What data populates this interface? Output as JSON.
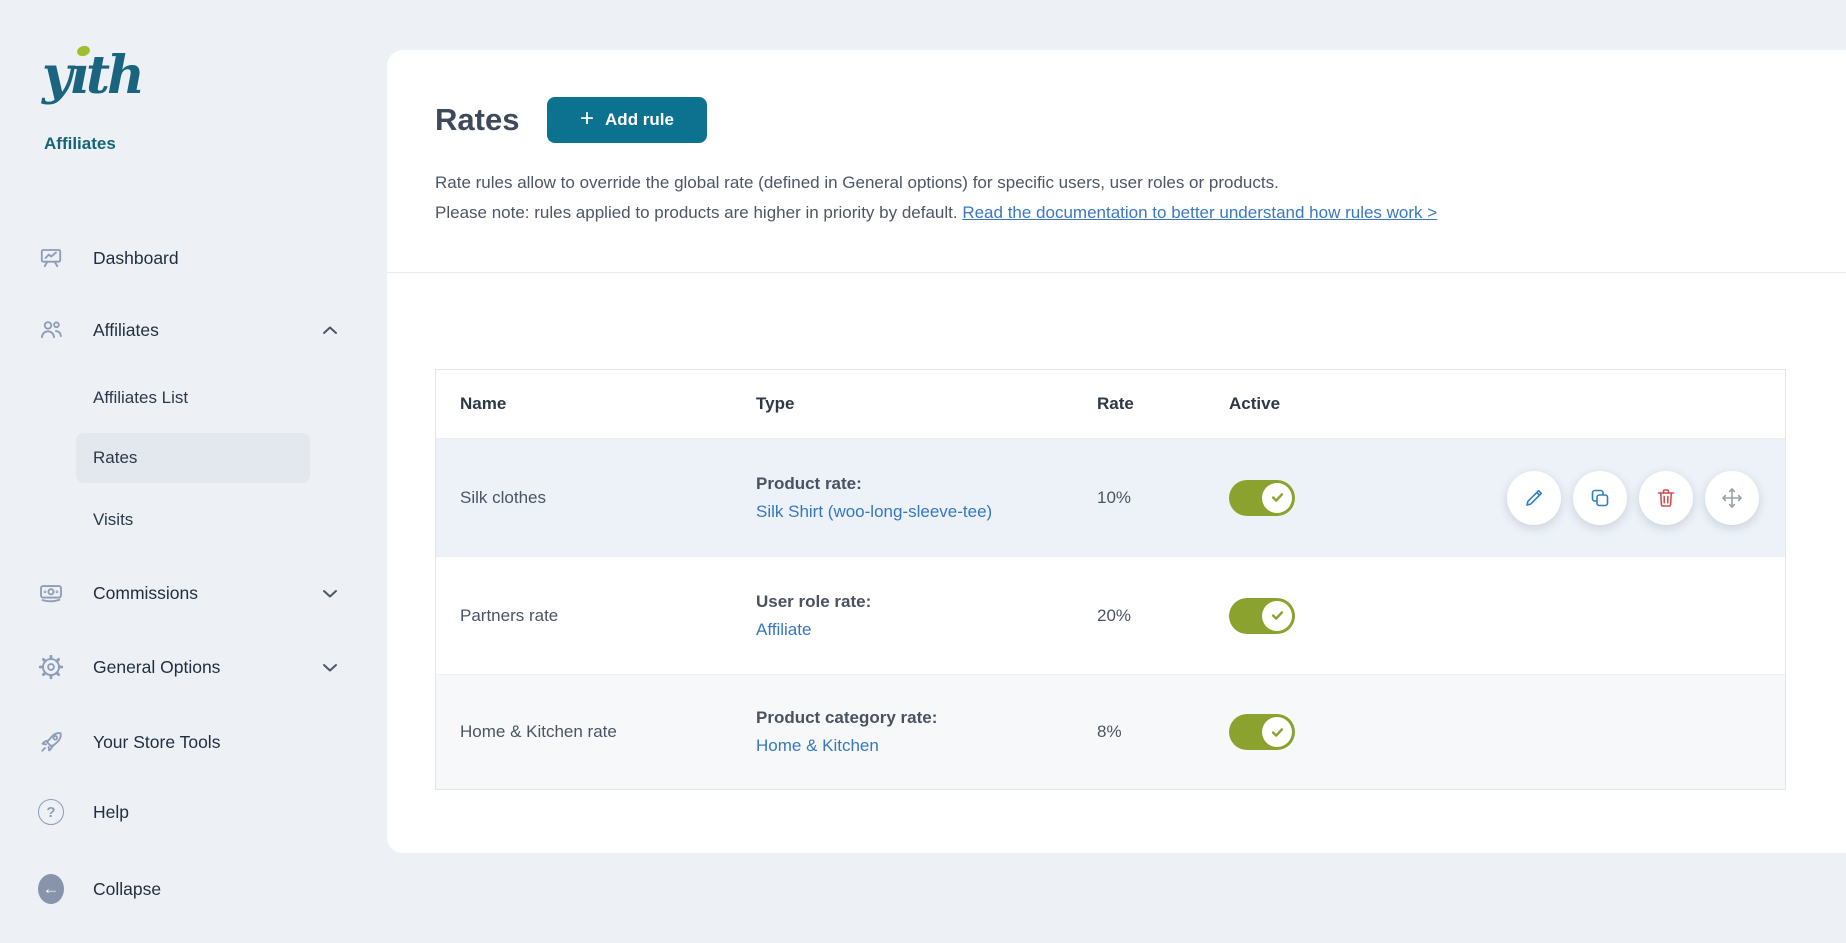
{
  "brand": {
    "logo": "yıth",
    "product": "Affiliates"
  },
  "glyphs": {
    "plus": "+",
    "question": "?",
    "back_arrow": "←"
  },
  "sidebar": {
    "items": [
      {
        "label": "Dashboard",
        "icon": "dashboard-icon"
      },
      {
        "label": "Affiliates",
        "icon": "users-icon",
        "chevron": "up",
        "expanded": true
      },
      {
        "label": "Affiliates List",
        "submenu": true
      },
      {
        "label": "Rates",
        "submenu": true,
        "active": true
      },
      {
        "label": "Visits",
        "submenu": true
      },
      {
        "label": "Commissions",
        "icon": "banknote-icon",
        "chevron": "down"
      },
      {
        "label": "General Options",
        "icon": "gear-icon",
        "chevron": "down"
      },
      {
        "label": "Your Store Tools",
        "icon": "rocket-icon"
      },
      {
        "label": "Help",
        "icon": "help-icon"
      },
      {
        "label": "Collapse",
        "icon": "collapse-arrow-icon"
      }
    ]
  },
  "header": {
    "title": "Rates",
    "add_rule_label": "Add rule",
    "description_line1": "Rate rules allow to override the global rate (defined in General options) for specific users, user roles or products.",
    "description_line2": "Please note: rules applied to products are higher in priority by default.",
    "doc_link": "Read the documentation to better understand how rules work >"
  },
  "table": {
    "columns": [
      "Name",
      "Type",
      "Rate",
      "Active"
    ],
    "rows": [
      {
        "name": "Silk clothes",
        "type_label": "Product rate:",
        "type_link": "Silk Shirt (woo-long-sleeve-tee)",
        "rate": "10%",
        "active": true
      },
      {
        "name": "Partners rate",
        "type_label": "User role rate:",
        "type_link": "Affiliate",
        "rate": "20%",
        "active": true
      },
      {
        "name": "Home & Kitchen rate",
        "type_label": "Product category rate:",
        "type_link": "Home & Kitchen",
        "rate": "8%",
        "active": true
      }
    ],
    "row_actions": [
      "edit",
      "duplicate",
      "delete",
      "move"
    ]
  },
  "colors": {
    "brand_teal": "#156579",
    "button_teal": "#0d7190",
    "link_blue": "#3a78c2",
    "toggle_green": "#8ba32e",
    "delete_red": "#cf5050",
    "hover_row": "#ecf2f8"
  }
}
